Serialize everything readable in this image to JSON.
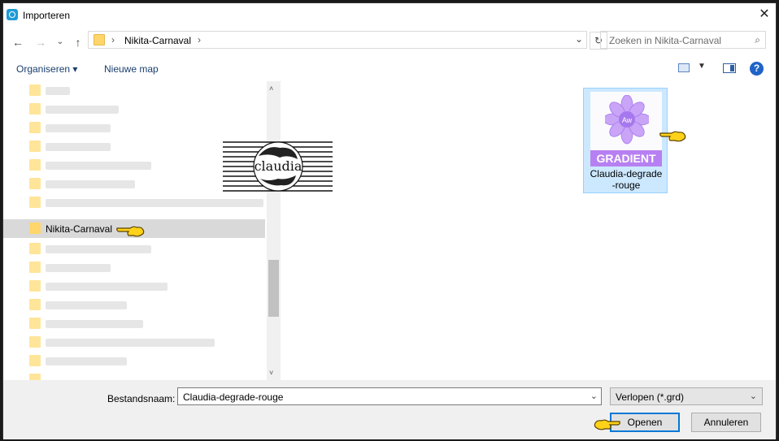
{
  "window": {
    "title": "Importeren",
    "close_glyph": "✕"
  },
  "nav": {
    "back_glyph": "←",
    "forward_glyph": "→",
    "recent_glyph": "⌄",
    "up_glyph": "↑",
    "crumb_sep": "›",
    "crumb": "Nikita-Carnaval",
    "refresh_glyph": "↻"
  },
  "search": {
    "placeholder": "Zoeken in Nikita-Carnaval",
    "icon": "search-icon"
  },
  "toolbar": {
    "organize": "Organiseren",
    "organize_arrow": "▾",
    "new_folder": "Nieuwe map",
    "help": "?"
  },
  "tree": {
    "selected_label": "Nikita-Carnaval"
  },
  "file": {
    "thumb_badge": "Aw",
    "thumb_band": "GRADIENT",
    "name": "Claudia-degrade\n-rouge"
  },
  "watermark": {
    "text": "claudia"
  },
  "footer": {
    "filename_label": "Bestandsnaam:",
    "filename_value": "Claudia-degrade-rouge",
    "filetype": "Verlopen (*.grd)",
    "open_button": "Openen",
    "cancel_button": "Annuleren"
  },
  "colors": {
    "accent": "#0078d7",
    "selection": "#cce8ff",
    "gradient_band": "#b780f2",
    "folder": "#ffd66b"
  }
}
